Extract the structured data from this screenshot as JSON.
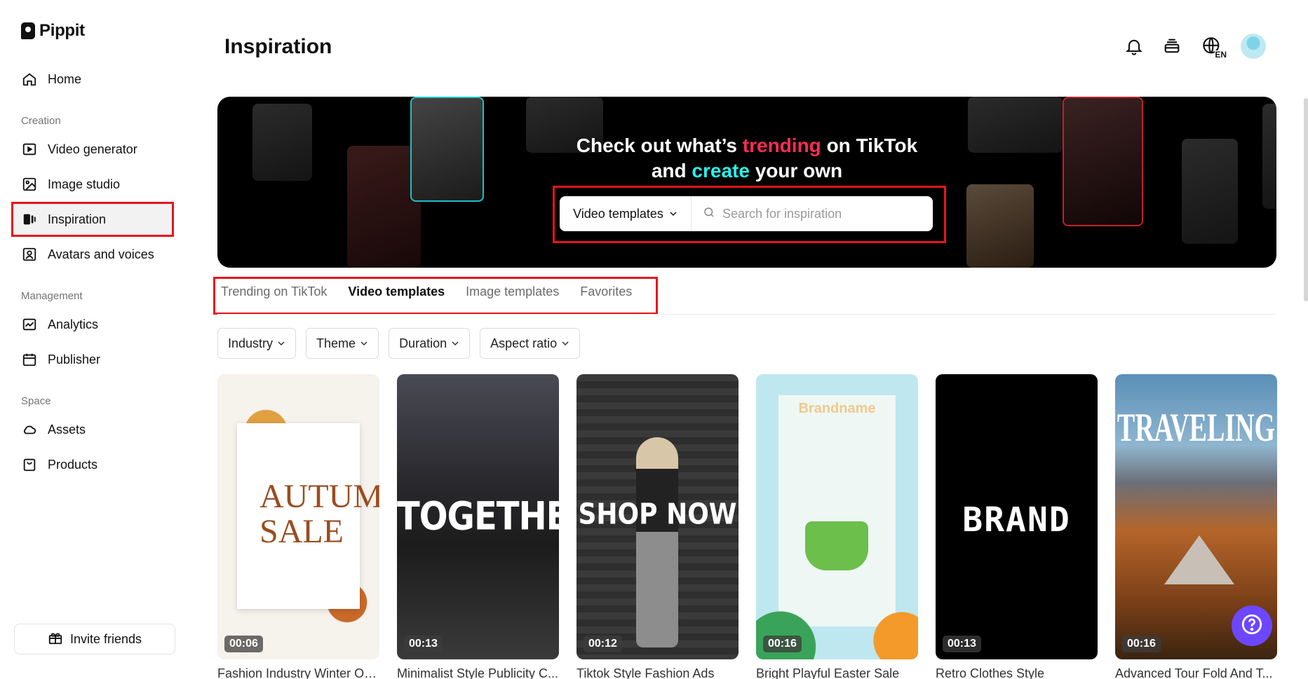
{
  "app": {
    "name": "Pippit"
  },
  "sidebar": {
    "home": "Home",
    "sections": {
      "creation": "Creation",
      "management": "Management",
      "space": "Space"
    },
    "items": {
      "video_generator": "Video generator",
      "image_studio": "Image studio",
      "inspiration": "Inspiration",
      "avatars_voices": "Avatars and voices",
      "analytics": "Analytics",
      "publisher": "Publisher",
      "assets": "Assets",
      "products": "Products"
    },
    "invite": "Invite friends"
  },
  "header": {
    "title": "Inspiration",
    "lang_badge": "EN"
  },
  "banner": {
    "line1_a": "Check out what’s ",
    "line1_trend": "trending",
    "line1_b": " on TikTok",
    "line2_a": "and ",
    "line2_create": "create",
    "line2_b": " your own",
    "dropdown_value": "Video templates",
    "search_placeholder": "Search for inspiration"
  },
  "tabs": [
    "Trending on TikTok",
    "Video templates",
    "Image templates",
    "Favorites"
  ],
  "active_tab": "Video templates",
  "filters": [
    "Industry",
    "Theme",
    "Duration",
    "Aspect ratio"
  ],
  "cards": [
    {
      "title": "Fashion Industry Winter Ou...",
      "duration": "00:06",
      "overlay": "AUTUMN SALE"
    },
    {
      "title": "Minimalist Style Publicity C...",
      "duration": "00:13",
      "overlay": "TOGETHER"
    },
    {
      "title": "Tiktok Style Fashion Ads",
      "duration": "00:12",
      "overlay": "SHOP NOW"
    },
    {
      "title": "Bright Playful Easter Sale",
      "duration": "00:16",
      "overlay": "Brandname"
    },
    {
      "title": "Retro Clothes Style",
      "duration": "00:13",
      "overlay": "BRAND"
    },
    {
      "title": "Advanced Tour Fold And T...",
      "duration": "00:16",
      "overlay": "TRAVELING"
    }
  ],
  "colors": {
    "accent_red": "#e8141c",
    "tiktok_pink": "#fe2c55",
    "tiktok_cyan": "#25f4ee",
    "help_purple": "#6c47ff"
  }
}
